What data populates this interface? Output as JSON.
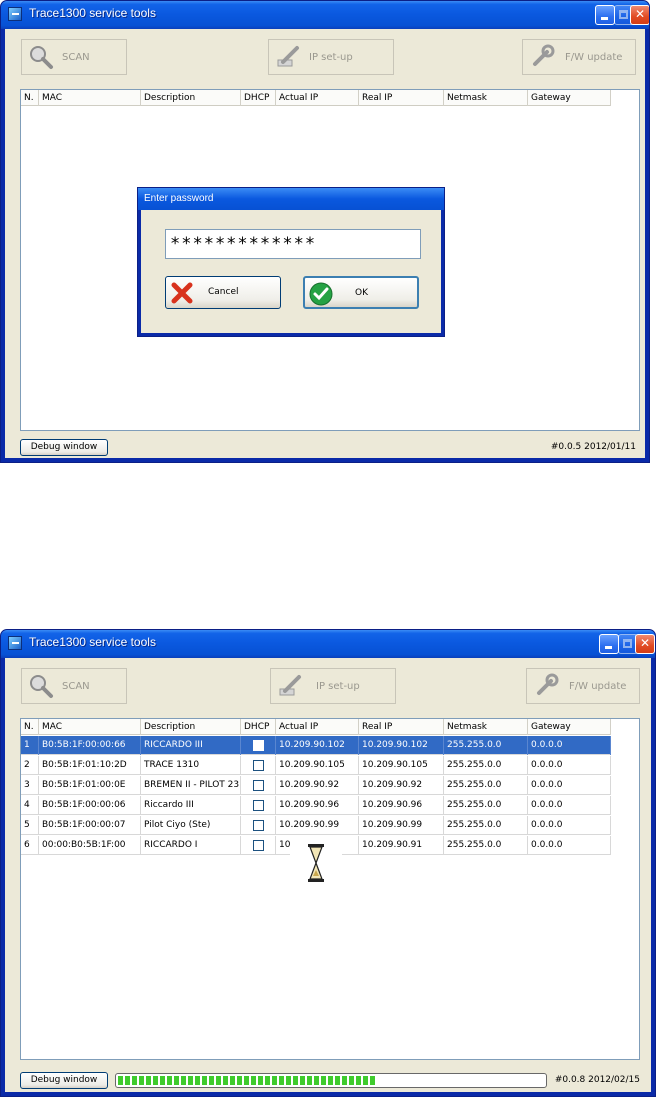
{
  "app": {
    "title": "Trace1300 service tools"
  },
  "toolbar": {
    "scan": "SCAN",
    "ip_setup": "IP set-up",
    "fw_update": "F/W update"
  },
  "columns": [
    "N.",
    "MAC",
    "Description",
    "DHCP",
    "Actual IP",
    "Real IP",
    "Netmask",
    "Gateway"
  ],
  "dialog": {
    "title": "Enter password",
    "password_mask": "*************",
    "cancel": "Cancel",
    "ok": "OK"
  },
  "screen1": {
    "debug": "Debug window",
    "version": "#0.0.5   2012/01/11"
  },
  "screen2": {
    "debug": "Debug window",
    "version": "#0.0.8   2012/02/15",
    "progress": 0.6,
    "rows": [
      [
        "1",
        "B0:5B:1F:00:00:66",
        "RICCARDO III",
        "10.209.90.102",
        "10.209.90.102",
        "255.255.0.0",
        "0.0.0.0"
      ],
      [
        "2",
        "B0:5B:1F:01:10:2D",
        "TRACE 1310",
        "10.209.90.105",
        "10.209.90.105",
        "255.255.0.0",
        "0.0.0.0"
      ],
      [
        "3",
        "B0:5B:1F:01:00:0E",
        "BREMEN II - PILOT 23",
        "10.209.90.92",
        "10.209.90.92",
        "255.255.0.0",
        "0.0.0.0"
      ],
      [
        "4",
        "B0:5B:1F:00:00:06",
        "Riccardo III",
        "10.209.90.96",
        "10.209.90.96",
        "255.255.0.0",
        "0.0.0.0"
      ],
      [
        "5",
        "B0:5B:1F:00:00:07",
        "Pilot Ciyo (Ste)",
        "10.209.90.99",
        "10.209.90.99",
        "255.255.0.0",
        "0.0.0.0"
      ],
      [
        "6",
        "00:00:B0:5B:1F:00",
        "RICCARDO I",
        "10",
        "10.209.90.91",
        "255.255.0.0",
        "0.0.0.0"
      ]
    ]
  }
}
